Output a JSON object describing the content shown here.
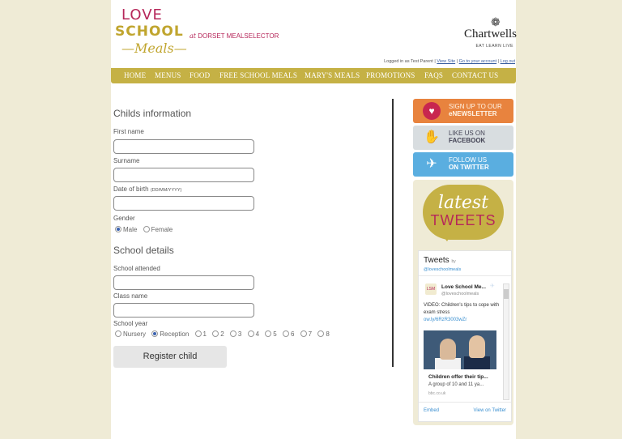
{
  "brand": {
    "logo_line1": "LOVE",
    "logo_line2": "SCHOOL",
    "logo_line3": "—Meals—",
    "at_prefix": "at",
    "site_name": "DORSET MEALSELECTOR",
    "partner_name": "Chartwells",
    "partner_tagline": "EAT LEARN LIVE",
    "colors": {
      "pink": "#b6275a",
      "gold": "#c5b145",
      "cream": "#efebd6"
    }
  },
  "account": {
    "logged_in_text": "Logged in as Test Parent |",
    "view_site": "View Site",
    "go_to_account": "Go to your account",
    "log_out": "Log out"
  },
  "nav": {
    "items": [
      "HOME",
      "MENUS",
      "FOOD",
      "FREE SCHOOL MEALS",
      "MARY'S MEALS",
      "PROMOTIONS",
      "FAQS",
      "CONTACT US"
    ]
  },
  "form": {
    "child_heading": "Childs information",
    "first_name_label": "First name",
    "surname_label": "Surname",
    "dob_label": "Date of birth",
    "dob_hint": "(DD/MM/YYYY)",
    "gender_label": "Gender",
    "gender_options": [
      "Male",
      "Female"
    ],
    "gender_selected": "Male",
    "school_heading": "School details",
    "school_attended_label": "School attended",
    "class_name_label": "Class name",
    "school_year_label": "School year",
    "year_options": [
      "Nursery",
      "Reception",
      "1",
      "2",
      "3",
      "4",
      "5",
      "6",
      "7",
      "8"
    ],
    "year_selected": "Reception",
    "register_label": "Register child"
  },
  "sidebar": {
    "newsletter_line1": "SIGN UP TO OUR",
    "newsletter_line2": "eNEWSLETTER",
    "facebook_line1": "LIKE US ON",
    "facebook_line2": "FACEBOOK",
    "twitter_line1": "FOLLOW US",
    "twitter_line2": "ON TWITTER",
    "latest_line1": "latest",
    "latest_line2": "TWEETS"
  },
  "twitter_widget": {
    "title": "Tweets",
    "by": "by",
    "handle": "@loveschoolmeals",
    "tweet_name": "Love School Me...",
    "tweet_user": "@loveschoolmeals",
    "tweet_text": "VIDEO: Children's tips to cope with exam stress",
    "tweet_link": "ow.ly/6RzR3003wZr",
    "card_title": "Children offer their tip...",
    "card_desc": "A group of 10 and 11 ya...",
    "card_source": "bbc.co.uk",
    "embed": "Embed",
    "view_on": "View on Twitter"
  }
}
